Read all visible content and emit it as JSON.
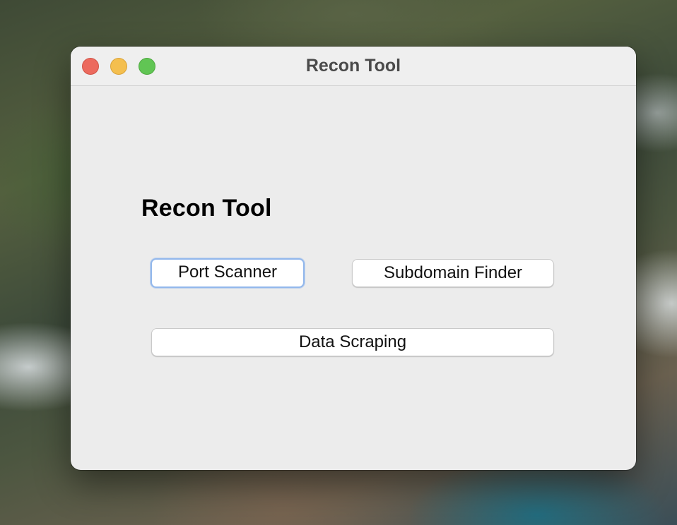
{
  "window": {
    "title": "Recon Tool"
  },
  "main": {
    "heading": "Recon Tool",
    "buttons": {
      "port_scanner": "Port Scanner",
      "subdomain_finder": "Subdomain Finder",
      "data_scraping": "Data Scraping"
    }
  },
  "colors": {
    "close": "#ec6a5e",
    "minimize": "#f4bf4f",
    "maximize": "#61c554",
    "focus_ring": "#93b8ec"
  }
}
